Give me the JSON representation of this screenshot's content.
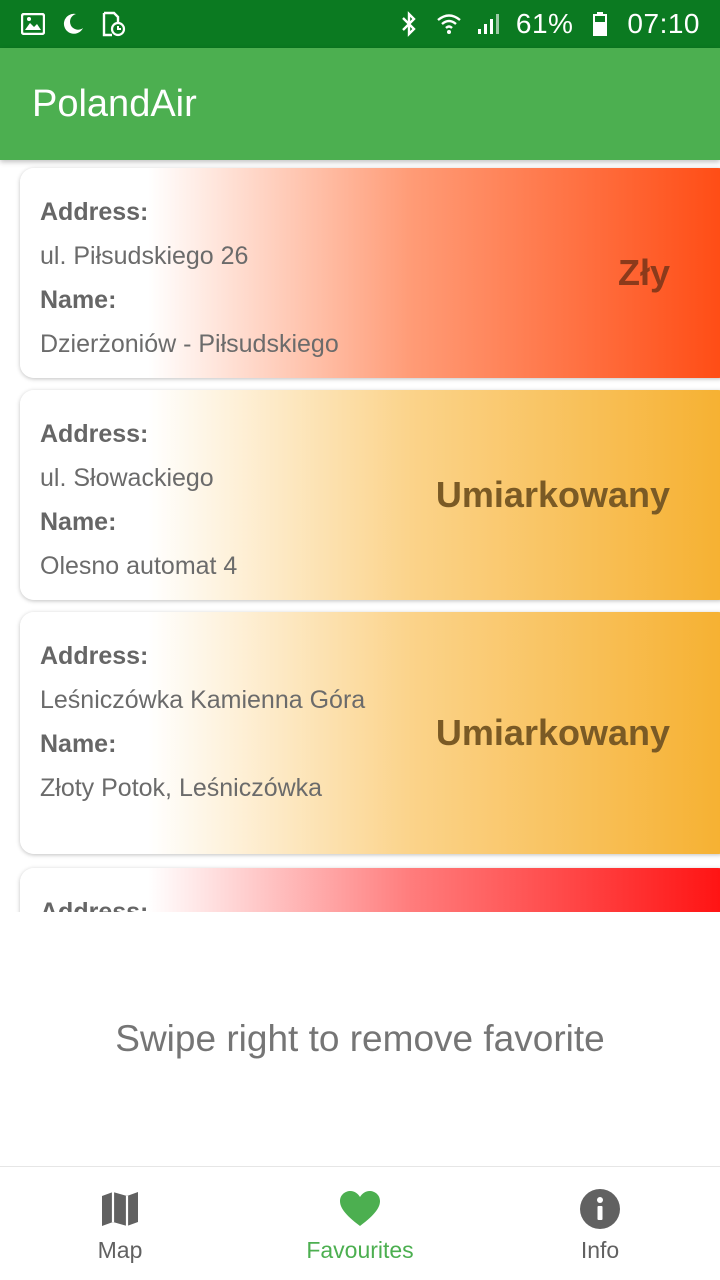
{
  "status_bar": {
    "battery": "61%",
    "time": "07:10",
    "icons_left": [
      "image-icon",
      "moon-icon",
      "sim-clock-icon"
    ],
    "icons_right": [
      "bluetooth-icon",
      "wifi-icon",
      "signal-icon",
      "battery-icon"
    ],
    "background": "#0b7a21"
  },
  "app_bar": {
    "title": "PolandAir",
    "background": "#4caf50"
  },
  "stations": [
    {
      "address_label": "Address:",
      "address": "ul. Piłsudskiego 26",
      "name_label": "Name:",
      "name": "Dzierżoniów - Piłsudskiego",
      "quality": "Zły",
      "color": "#ff4a12"
    },
    {
      "address_label": "Address:",
      "address": "ul. Słowackiego",
      "name_label": "Name:",
      "name": "Olesno automat 4",
      "quality": "Umiarkowany",
      "color": "#f6b02f"
    },
    {
      "address_label": "Address:",
      "address": "Leśniczówka Kamienna Góra",
      "name_label": "Name:",
      "name": "Złoty Potok, Leśniczówka",
      "quality": "Umiarkowany",
      "color": "#f6b02f"
    },
    {
      "address_label": "Address:",
      "color": "#ff1010"
    }
  ],
  "hint": "Swipe right to remove favorite",
  "bottom_nav": {
    "items": [
      {
        "label": "Map",
        "icon": "map-icon",
        "active": false
      },
      {
        "label": "Favourites",
        "icon": "heart-icon",
        "active": true
      },
      {
        "label": "Info",
        "icon": "info-icon",
        "active": false
      }
    ],
    "active_color": "#4caf50"
  }
}
